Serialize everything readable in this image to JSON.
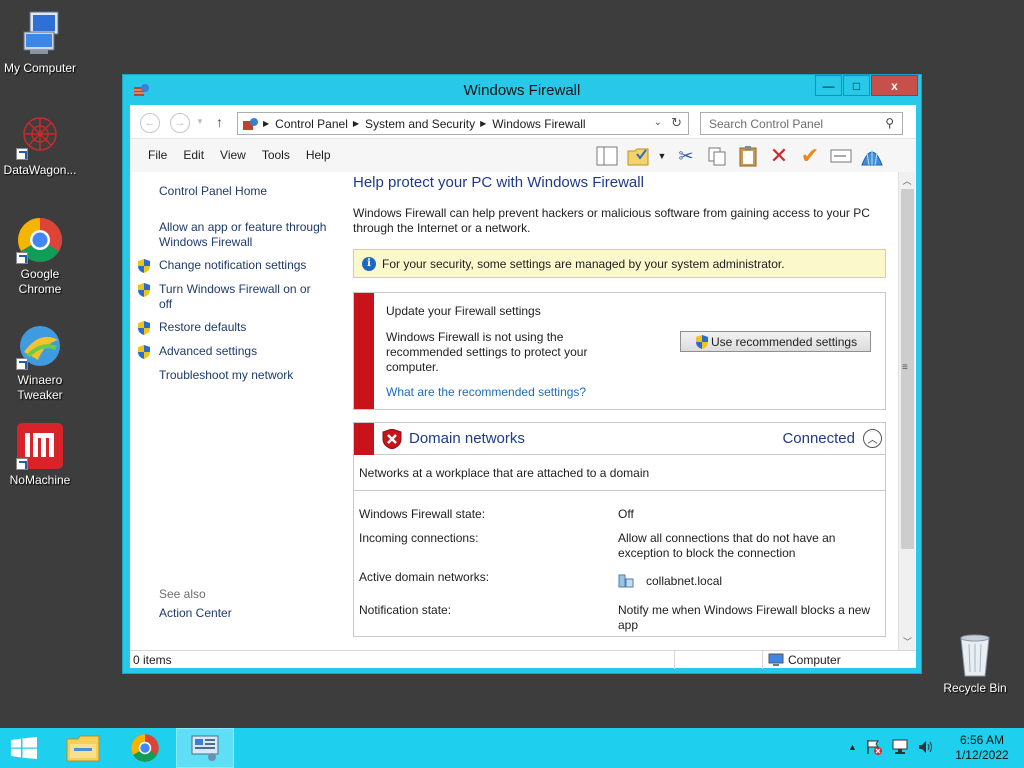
{
  "desktop": {
    "icons": [
      {
        "label": "My Computer"
      },
      {
        "label": "DataWagon..."
      },
      {
        "label": "Google Chrome"
      },
      {
        "label": "Winaero Tweaker"
      },
      {
        "label": "NoMachine"
      },
      {
        "label": "Recycle Bin"
      }
    ]
  },
  "window": {
    "title": "Windows Firewall",
    "buttons": {
      "minimize": "—",
      "maximize": "□",
      "close": "x"
    }
  },
  "address": {
    "crumbs": [
      "Control Panel",
      "System and Security",
      "Windows Firewall"
    ],
    "search_placeholder": "Search Control Panel"
  },
  "menu": [
    "File",
    "Edit",
    "View",
    "Tools",
    "Help"
  ],
  "left_pane": {
    "home": "Control Panel Home",
    "allow_app": "Allow an app or feature through Windows Firewall",
    "change_notify": "Change notification settings",
    "turn_on_off": "Turn Windows Firewall on or off",
    "restore": "Restore defaults",
    "advanced": "Advanced settings",
    "troubleshoot": "Troubleshoot my network",
    "see_also": "See also",
    "action_center": "Action Center"
  },
  "main": {
    "heading": "Help protect your PC with Windows Firewall",
    "intro": "Windows Firewall can help prevent hackers or malicious software from gaining access to your PC through the Internet or a network.",
    "info_bar": "For your security, some settings are managed by your system administrator.",
    "update": {
      "title": "Update your Firewall settings",
      "body": "Windows Firewall is not using the recommended settings to protect your computer.",
      "link": "What are the recommended settings?",
      "button": "Use recommended settings"
    },
    "domain": {
      "name": "Domain networks",
      "status": "Connected",
      "description": "Networks at a workplace that are attached to a domain",
      "rows": {
        "state_label": "Windows Firewall state:",
        "state_value": "Off",
        "incoming_label": "Incoming connections:",
        "incoming_value": "Allow all connections that do not have an exception to block the connection",
        "active_label": "Active domain networks:",
        "active_value": "collabnet.local",
        "notify_label": "Notification state:",
        "notify_value": "Notify me when Windows Firewall blocks a new app"
      }
    }
  },
  "status_bar": {
    "items": "0 items",
    "zone": "Computer"
  },
  "taskbar": {
    "time": "6:56 AM",
    "date": "1/12/2022"
  },
  "colors": {
    "window_frame": "#27c8e8",
    "taskbar": "#1ecfee",
    "alert_red": "#c8131b",
    "heading_blue": "#1e3a88",
    "link_blue": "#1e6cba",
    "info_yellow": "#fbf9cc"
  }
}
